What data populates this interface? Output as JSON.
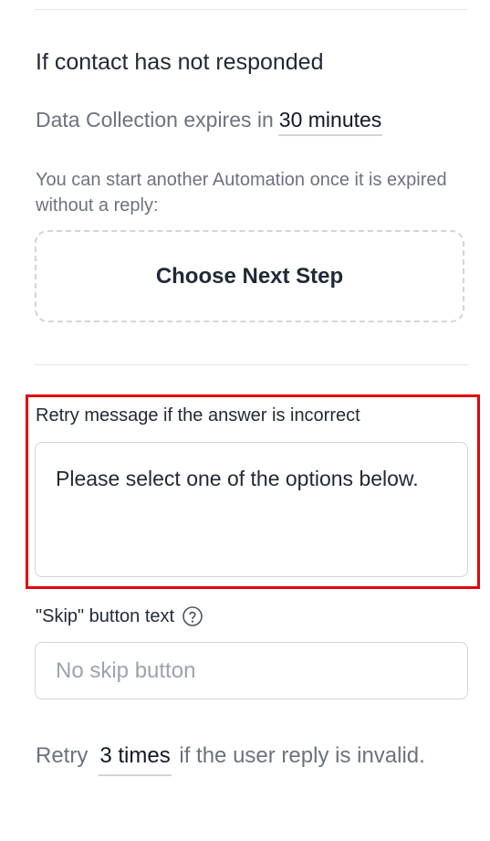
{
  "timeout_section": {
    "title": "If contact has not responded",
    "expires_prefix": "Data Collection expires in",
    "expires_value": "30 minutes",
    "hint": "You can start another Automation once it is expired without a reply:",
    "next_step_label": "Choose Next Step"
  },
  "retry_message": {
    "label": "Retry message if the answer is incorrect",
    "value": "Please select one of the options below."
  },
  "skip_button": {
    "label": "\"Skip\" button text",
    "help_icon": "question-circle-icon",
    "placeholder": "No skip button",
    "value": ""
  },
  "retry_count": {
    "prefix": "Retry",
    "value": "3 times",
    "suffix": "if the user reply is invalid."
  },
  "colors": {
    "highlight": "#e3000f",
    "muted_text": "#6b7280",
    "border": "#d1d5db"
  }
}
